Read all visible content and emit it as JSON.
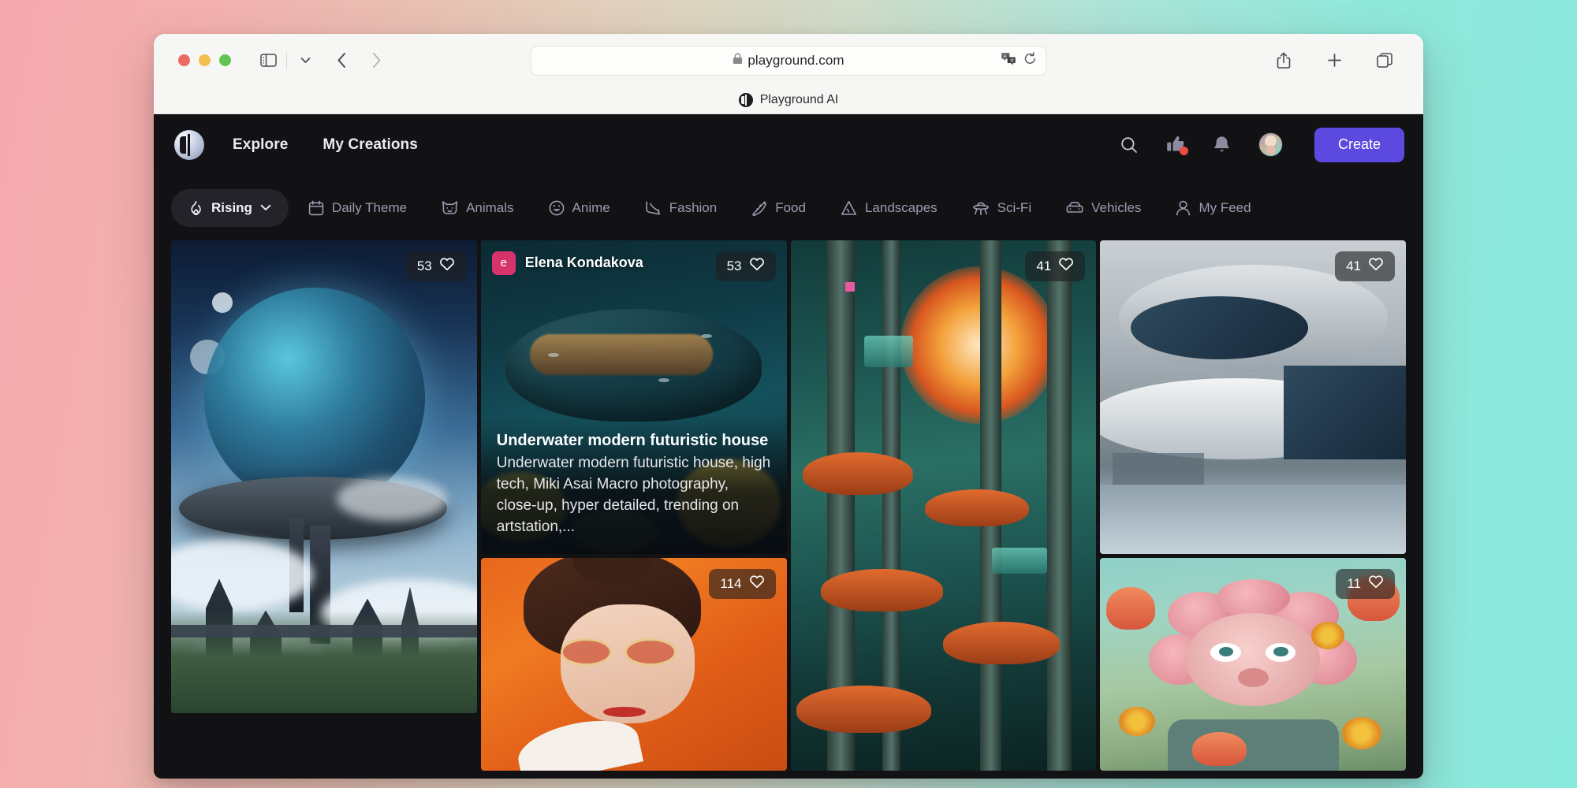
{
  "browser": {
    "url": "playground.com",
    "lock_icon": "lock-icon",
    "translate_icon": "translate-icon",
    "reload_icon": "reload-icon",
    "sidebar_icon": "sidebar-icon",
    "chevron_down_icon": "chevron-down-icon",
    "back_icon": "back-arrow-icon",
    "forward_icon": "forward-arrow-icon",
    "share_icon": "share-icon",
    "new_tab_icon": "plus-icon",
    "tabs_icon": "tab-overview-icon",
    "tab_title": "Playground AI"
  },
  "appnav": {
    "logo": "playground-logo-icon",
    "links": [
      {
        "label": "Explore"
      },
      {
        "label": "My Creations"
      }
    ],
    "icons": [
      {
        "name": "search-icon"
      },
      {
        "name": "thumbs-up-icon",
        "has_badge": true
      },
      {
        "name": "bell-icon"
      }
    ],
    "avatar": "user-avatar",
    "create_label": "Create"
  },
  "chips": [
    {
      "label": "Rising",
      "icon": "flame-icon",
      "active": true,
      "has_chevron": true
    },
    {
      "label": "Daily Theme",
      "icon": "calendar-icon",
      "active": false
    },
    {
      "label": "Animals",
      "icon": "cat-icon",
      "active": false
    },
    {
      "label": "Anime",
      "icon": "smiley-icon",
      "active": false
    },
    {
      "label": "Fashion",
      "icon": "high-heel-icon",
      "active": false
    },
    {
      "label": "Food",
      "icon": "pizza-icon",
      "active": false
    },
    {
      "label": "Landscapes",
      "icon": "mountain-icon",
      "active": false
    },
    {
      "label": "Sci-Fi",
      "icon": "ufo-icon",
      "active": false
    },
    {
      "label": "Vehicles",
      "icon": "car-icon",
      "active": false
    },
    {
      "label": "My Feed",
      "icon": "person-icon",
      "active": false
    }
  ],
  "cards": [
    {
      "id": "floating-city",
      "likes": "53",
      "heart_icon": "heart-icon",
      "hovered": false
    },
    {
      "id": "underwater-house",
      "likes": "53",
      "heart_icon": "heart-icon",
      "hovered": true,
      "author": "Elena Kondakova",
      "author_initial": "e",
      "title": "Underwater modern futuristic house",
      "description": "Underwater modern futuristic house, high tech, Miki Asai Macro photography, close-up, hyper detailed, trending on artstation,..."
    },
    {
      "id": "biopunk-towers",
      "likes": "41",
      "heart_icon": "heart-icon",
      "hovered": false
    },
    {
      "id": "curved-architecture",
      "likes": "41",
      "heart_icon": "heart-icon",
      "hovered": false
    },
    {
      "id": "orange-portrait",
      "likes": "114",
      "heart_icon": "heart-icon",
      "hovered": false
    },
    {
      "id": "flower-creature",
      "likes": "11",
      "heart_icon": "heart-icon",
      "hovered": false
    }
  ],
  "colors": {
    "accent": "#5c4ae0",
    "app_bg": "#121214",
    "chip_active_bg": "#232329",
    "notification_dot": "#ef4b44",
    "author_avatar_bg": "#d6336c"
  }
}
